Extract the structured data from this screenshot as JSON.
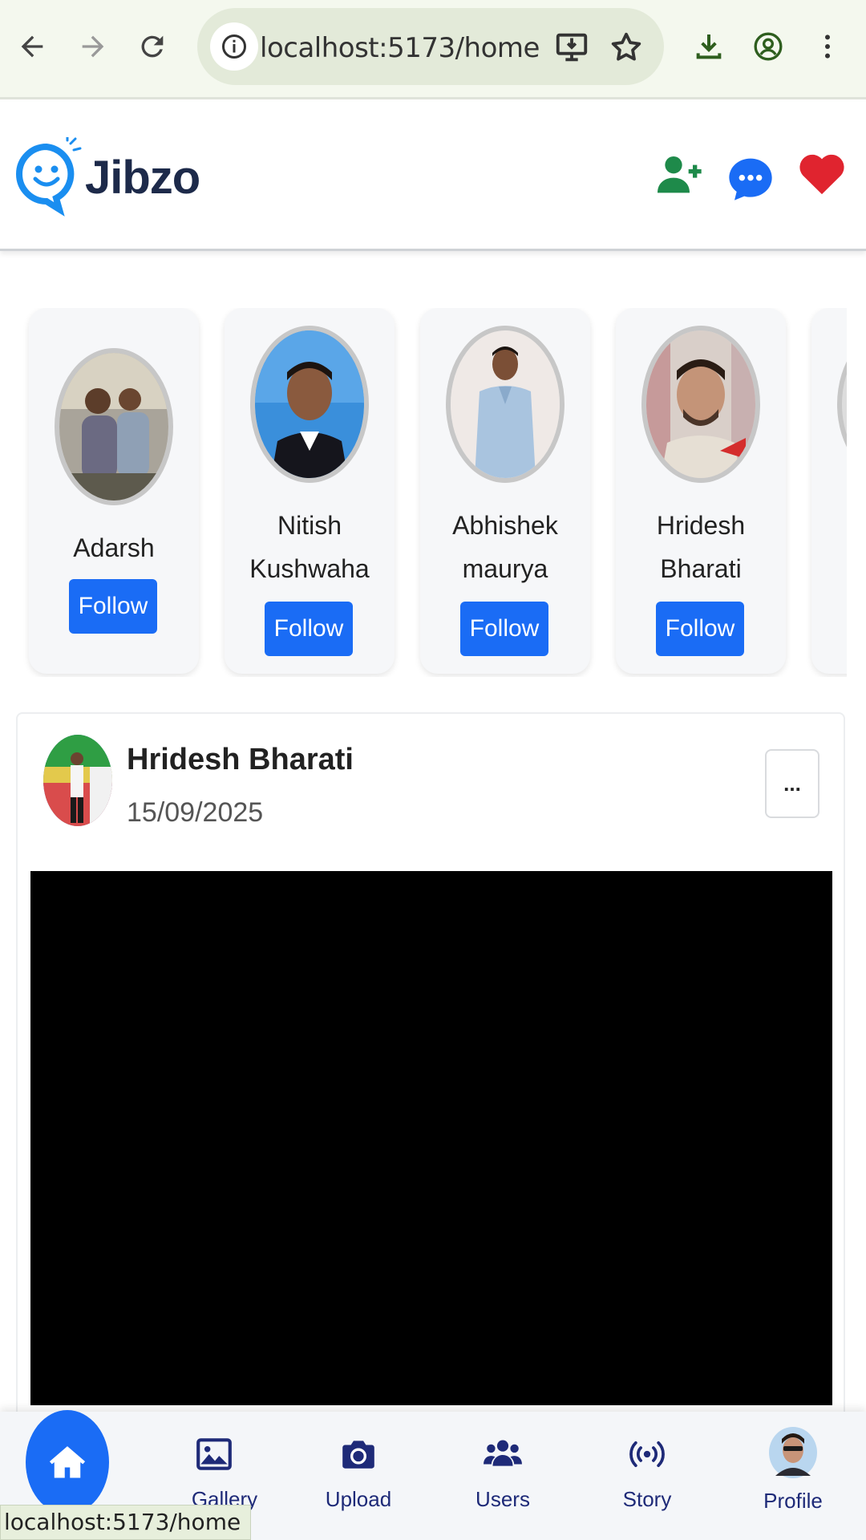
{
  "browser": {
    "url": "localhost:5173/home",
    "status_url": "localhost:5173/home"
  },
  "app": {
    "brand": "Jibzo"
  },
  "suggestions": [
    {
      "name": "Adarsh",
      "follow_label": "Follow"
    },
    {
      "name": "Nitish Kushwaha",
      "follow_label": "Follow"
    },
    {
      "name": "Abhishek maurya",
      "follow_label": "Follow"
    },
    {
      "name": "Hridesh Bharati",
      "follow_label": "Follow"
    }
  ],
  "post": {
    "author": "Hridesh Bharati",
    "date": "15/09/2025",
    "menu_label": "..."
  },
  "bottom_nav": {
    "items": [
      {
        "label": "Home",
        "icon": "home-icon"
      },
      {
        "label": "Gallery",
        "icon": "image-icon"
      },
      {
        "label": "Upload",
        "icon": "camera-icon"
      },
      {
        "label": "Users",
        "icon": "users-icon"
      },
      {
        "label": "Story",
        "icon": "broadcast-icon"
      },
      {
        "label": "Profile",
        "icon": "avatar"
      }
    ]
  },
  "colors": {
    "accent": "#1a6cf5",
    "nav_text": "#1e2a78",
    "heart": "#e0242f",
    "add_user": "#1e8a4a"
  }
}
